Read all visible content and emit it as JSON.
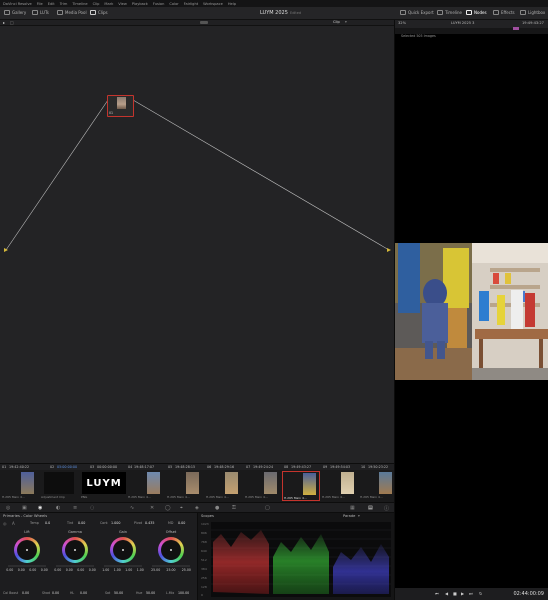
{
  "menu": [
    "DaVinci Resolve",
    "File",
    "Edit",
    "Trim",
    "Timeline",
    "Clip",
    "Mark",
    "View",
    "Playback",
    "Fusion",
    "Color",
    "Fairlight",
    "Workspace",
    "Help"
  ],
  "toolbar": {
    "left": [
      "Gallery",
      "LUTs",
      "Media Pool",
      "Clips"
    ],
    "project_title": "LUYM 2025",
    "edited": "Edited",
    "right": [
      "Quick Export",
      "Timeline",
      "Nodes",
      "Effects",
      "Lightbox"
    ],
    "clip_dropdown": "Clip"
  },
  "viewer": {
    "zoom": "32%",
    "timeline_name": "LUYM 2025 3",
    "timecode_top": "19:49:43:27",
    "selected_label": "Selected 505 Images",
    "timecode": "02:44:00:09"
  },
  "node": {
    "label": "01"
  },
  "clips": [
    {
      "num": "01",
      "tc": "19:42:40:22",
      "label": "H.265 Main 4..."
    },
    {
      "num": "02",
      "tc": "05:00:00:00",
      "label": "Adjustment Clip"
    },
    {
      "num": "03",
      "tc": "00:00:00:00",
      "label": "PNG"
    },
    {
      "num": "04",
      "tc": "19:48:17:07",
      "label": "H.265 Main 4..."
    },
    {
      "num": "05",
      "tc": "19:48:28:15",
      "label": "H.265 Main 4..."
    },
    {
      "num": "06",
      "tc": "19:48:29:16",
      "label": "H.265 Main 4..."
    },
    {
      "num": "07",
      "tc": "19:49:24:24",
      "label": "H.265 Main 4..."
    },
    {
      "num": "08",
      "tc": "19:49:43:27",
      "label": "H.265 Main 4..."
    },
    {
      "num": "09",
      "tc": "19:49:54:03",
      "label": "H.265 Main 4..."
    },
    {
      "num": "10",
      "tc": "19:50:23:22",
      "label": "H.265 Main 4..."
    }
  ],
  "color_wheels": {
    "title": "Primaries - Color Wheels",
    "temp": {
      "label": "Temp",
      "value": "0.0"
    },
    "tint": {
      "label": "Tint",
      "value": "0.00"
    },
    "contrast": {
      "label": "Cont",
      "value": "1.000"
    },
    "pivot": {
      "label": "Pivot",
      "value": "0.435"
    },
    "md": {
      "label": "MD",
      "value": "0.00"
    },
    "wheels": [
      {
        "name": "Lift",
        "values": [
          "0.00",
          "0.00",
          "0.00",
          "0.00"
        ]
      },
      {
        "name": "Gamma",
        "values": [
          "0.00",
          "0.00",
          "0.00",
          "0.00"
        ]
      },
      {
        "name": "Gain",
        "values": [
          "1.00",
          "1.00",
          "1.00",
          "1.00"
        ]
      },
      {
        "name": "Offset",
        "values": [
          "25.00",
          "25.00",
          "25.00"
        ]
      }
    ],
    "bottom": [
      {
        "label": "Col Boost",
        "value": "0.00"
      },
      {
        "label": "Shad",
        "value": "0.00"
      },
      {
        "label": "HL",
        "value": "0.00"
      },
      {
        "label": "Sat",
        "value": "50.00"
      },
      {
        "label": "Hue",
        "value": "50.00"
      },
      {
        "label": "L.Mix",
        "value": "100.00"
      }
    ]
  },
  "scopes": {
    "title": "Scopes",
    "mode": "Parade",
    "ylabels": [
      "1023",
      "896",
      "768",
      "640",
      "512",
      "384",
      "256",
      "128",
      "0"
    ]
  },
  "colors": {
    "accent": "#c4342d",
    "bg": "#1b1b1d"
  }
}
